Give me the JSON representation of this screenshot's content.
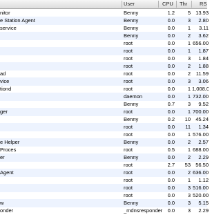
{
  "columns": {
    "user": "User",
    "cpu": "CPU",
    "thr": "Thr",
    "rs": "RS"
  },
  "rows": [
    {
      "name": "nitor",
      "user": "Benny",
      "cpu": "1.2",
      "thr": "5",
      "rs": "13.93"
    },
    {
      "name": "e Station Agent",
      "user": "Benny",
      "cpu": "0.0",
      "thr": "3",
      "rs": "2.80"
    },
    {
      "name": "service",
      "user": "Benny",
      "cpu": "0.0",
      "thr": "1",
      "rs": "3.11"
    },
    {
      "name": "",
      "user": "Benny",
      "cpu": "0.0",
      "thr": "2",
      "rs": "3.62"
    },
    {
      "name": "",
      "user": "root",
      "cpu": "0.0",
      "thr": "1",
      "rs": "656.00"
    },
    {
      "name": "",
      "user": "root",
      "cpu": "0.0",
      "thr": "1",
      "rs": "1.87"
    },
    {
      "name": "",
      "user": "root",
      "cpu": "0.0",
      "thr": "3",
      "rs": "1.84"
    },
    {
      "name": "",
      "user": "root",
      "cpu": "0.0",
      "thr": "2",
      "rs": "1.88"
    },
    {
      "name": "ad",
      "user": "root",
      "cpu": "0.0",
      "thr": "2",
      "rs": "11.59"
    },
    {
      "name": "vice",
      "user": "root",
      "cpu": "0.0",
      "thr": "3",
      "rs": "3.06"
    },
    {
      "name": "tiond",
      "user": "root",
      "cpu": "0.0",
      "thr": "1",
      "rs": "1,008.0"
    },
    {
      "name": "",
      "user": "daemon",
      "cpu": "0.0",
      "thr": "1",
      "rs": "732.00"
    },
    {
      "name": "",
      "user": "Benny",
      "cpu": "0.7",
      "thr": "3",
      "rs": "9.52"
    },
    {
      "name": "ger",
      "user": "root",
      "cpu": "0.0",
      "thr": "1",
      "rs": "700.00"
    },
    {
      "name": "",
      "user": "Benny",
      "cpu": "0.2",
      "thr": "10",
      "rs": "45.24"
    },
    {
      "name": "",
      "user": "root",
      "cpu": "0.0",
      "thr": "11",
      "rs": "1.34"
    },
    {
      "name": "",
      "user": "root",
      "cpu": "0.0",
      "thr": "1",
      "rs": "576.00"
    },
    {
      "name": "e Helper",
      "user": "Benny",
      "cpu": "0.0",
      "thr": "2",
      "rs": "2.57"
    },
    {
      "name": "Proces",
      "user": "root",
      "cpu": "0.5",
      "thr": "1",
      "rs": "688.00"
    },
    {
      "name": "er",
      "user": "Benny",
      "cpu": "0.0",
      "thr": "2",
      "rs": "2.29"
    },
    {
      "name": "",
      "user": "root",
      "cpu": "2.7",
      "thr": "53",
      "rs": "56.50"
    },
    {
      "name": "Agent",
      "user": "root",
      "cpu": "0.0",
      "thr": "2",
      "rs": "636.00"
    },
    {
      "name": "",
      "user": "root",
      "cpu": "0.0",
      "thr": "1",
      "rs": "1.12"
    },
    {
      "name": "",
      "user": "root",
      "cpu": "0.0",
      "thr": "3",
      "rs": "516.00"
    },
    {
      "name": "",
      "user": "root",
      "cpu": "0.0",
      "thr": "3",
      "rs": "520.00"
    },
    {
      "name": "w",
      "user": "Benny",
      "cpu": "0.0",
      "thr": "3",
      "rs": "5.15"
    },
    {
      "name": "onder",
      "user": "_mdnsresponder",
      "cpu": "0.0",
      "thr": "3",
      "rs": "2.29"
    }
  ]
}
